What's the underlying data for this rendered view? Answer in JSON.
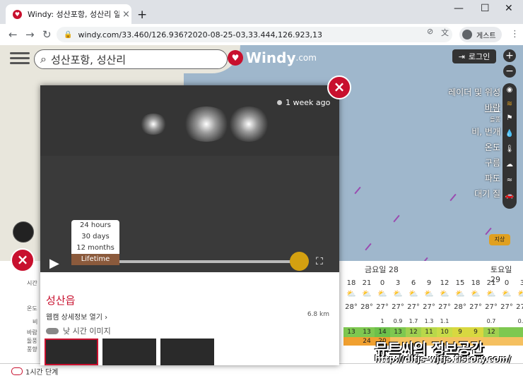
{
  "browser": {
    "tab_title": "Windy: 성산포항, 성산리 일기 예보",
    "url": "windy.com/33.460/126.936?2020-08-25-03,33.444,126.923,13",
    "profile_label": "게스트"
  },
  "map": {
    "search_text": "성산포항, 성산리",
    "logo_text": "Windy",
    "logo_com": ".com",
    "login_label": "로그인",
    "zoom_in": "+",
    "zoom_out": "−",
    "layers": [
      "레이더 및 위성",
      "바람",
      "돌풍",
      "비, 번개",
      "온도",
      "구름",
      "파도",
      "대기 질"
    ],
    "ground_label": "지상"
  },
  "webcam": {
    "age": "1 week ago",
    "ranges": [
      "24 hours",
      "30 days",
      "12 months",
      "Lifetime"
    ],
    "active_range": "Lifetime",
    "place": "성산읍",
    "detail_link": "웹캠 상세정보 열기",
    "distance": "6.8 km",
    "daylight_label": "낮 시간 이미지",
    "close": "×"
  },
  "forecast": {
    "days": [
      "금요일 28",
      "토요일 29"
    ],
    "hours": [
      "18",
      "21",
      "0",
      "3",
      "6",
      "9",
      "12",
      "15",
      "18",
      "21",
      "0",
      "3"
    ],
    "temps": [
      "28°",
      "28°",
      "27°",
      "27°",
      "27°",
      "27°",
      "27°",
      "28°",
      "27°",
      "27°",
      "27°",
      "27°"
    ],
    "rain": [
      "",
      "",
      "1",
      "0.9",
      "1.7",
      "1.3",
      "1.1",
      "",
      "",
      "0.7",
      "",
      "0.4"
    ],
    "wind": [
      "13",
      "13",
      "14",
      "13",
      "12",
      "11",
      "10",
      "9",
      "9",
      "12",
      "",
      ""
    ],
    "gust": [
      "",
      "24",
      "20",
      "",
      "",
      "",
      "",
      "",
      "",
      "",
      "",
      ""
    ],
    "side_labels": [
      "시간",
      "온도",
      "비",
      "바람",
      "돌풍",
      "풍향"
    ],
    "bottom_label": "1시간 단계"
  },
  "watermark": {
    "title": "뮤트씨의 정보공간",
    "url": "http://dlfjs-wjfjs.tistory.com/"
  },
  "colors": {
    "windy_red": "#c8102e",
    "accent_gold": "#d4a010",
    "sea": "#9fb7cc"
  }
}
